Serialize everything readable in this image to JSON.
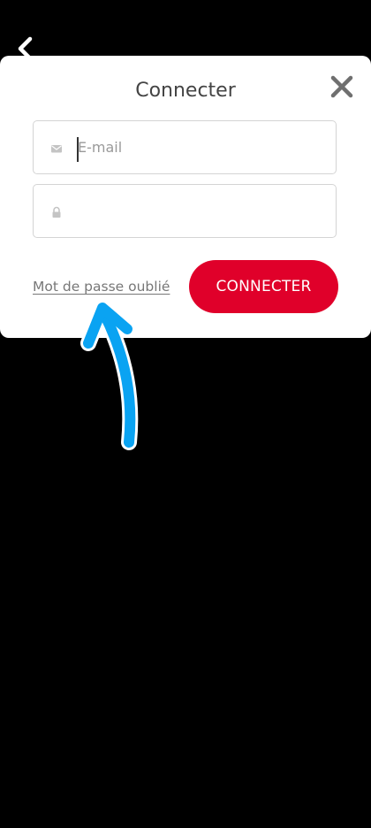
{
  "navigation": {
    "back_icon": "chevron-left-icon"
  },
  "modal": {
    "title": "Connecter",
    "close_icon": "close-icon",
    "email_field": {
      "placeholder": "E-mail",
      "value": "",
      "icon": "envelope-icon"
    },
    "password_field": {
      "placeholder": "",
      "value": "",
      "icon": "lock-icon"
    },
    "forgot_password_label": "Mot de passe oublié",
    "connect_label": "CONNECTER"
  },
  "annotation": {
    "icon": "arrow-up-annotation-icon",
    "color": "#0aa3f2"
  },
  "colors": {
    "background": "#000000",
    "modal_background": "#ffffff",
    "accent": "#e0002a",
    "link": "#777777",
    "title": "#444444"
  }
}
